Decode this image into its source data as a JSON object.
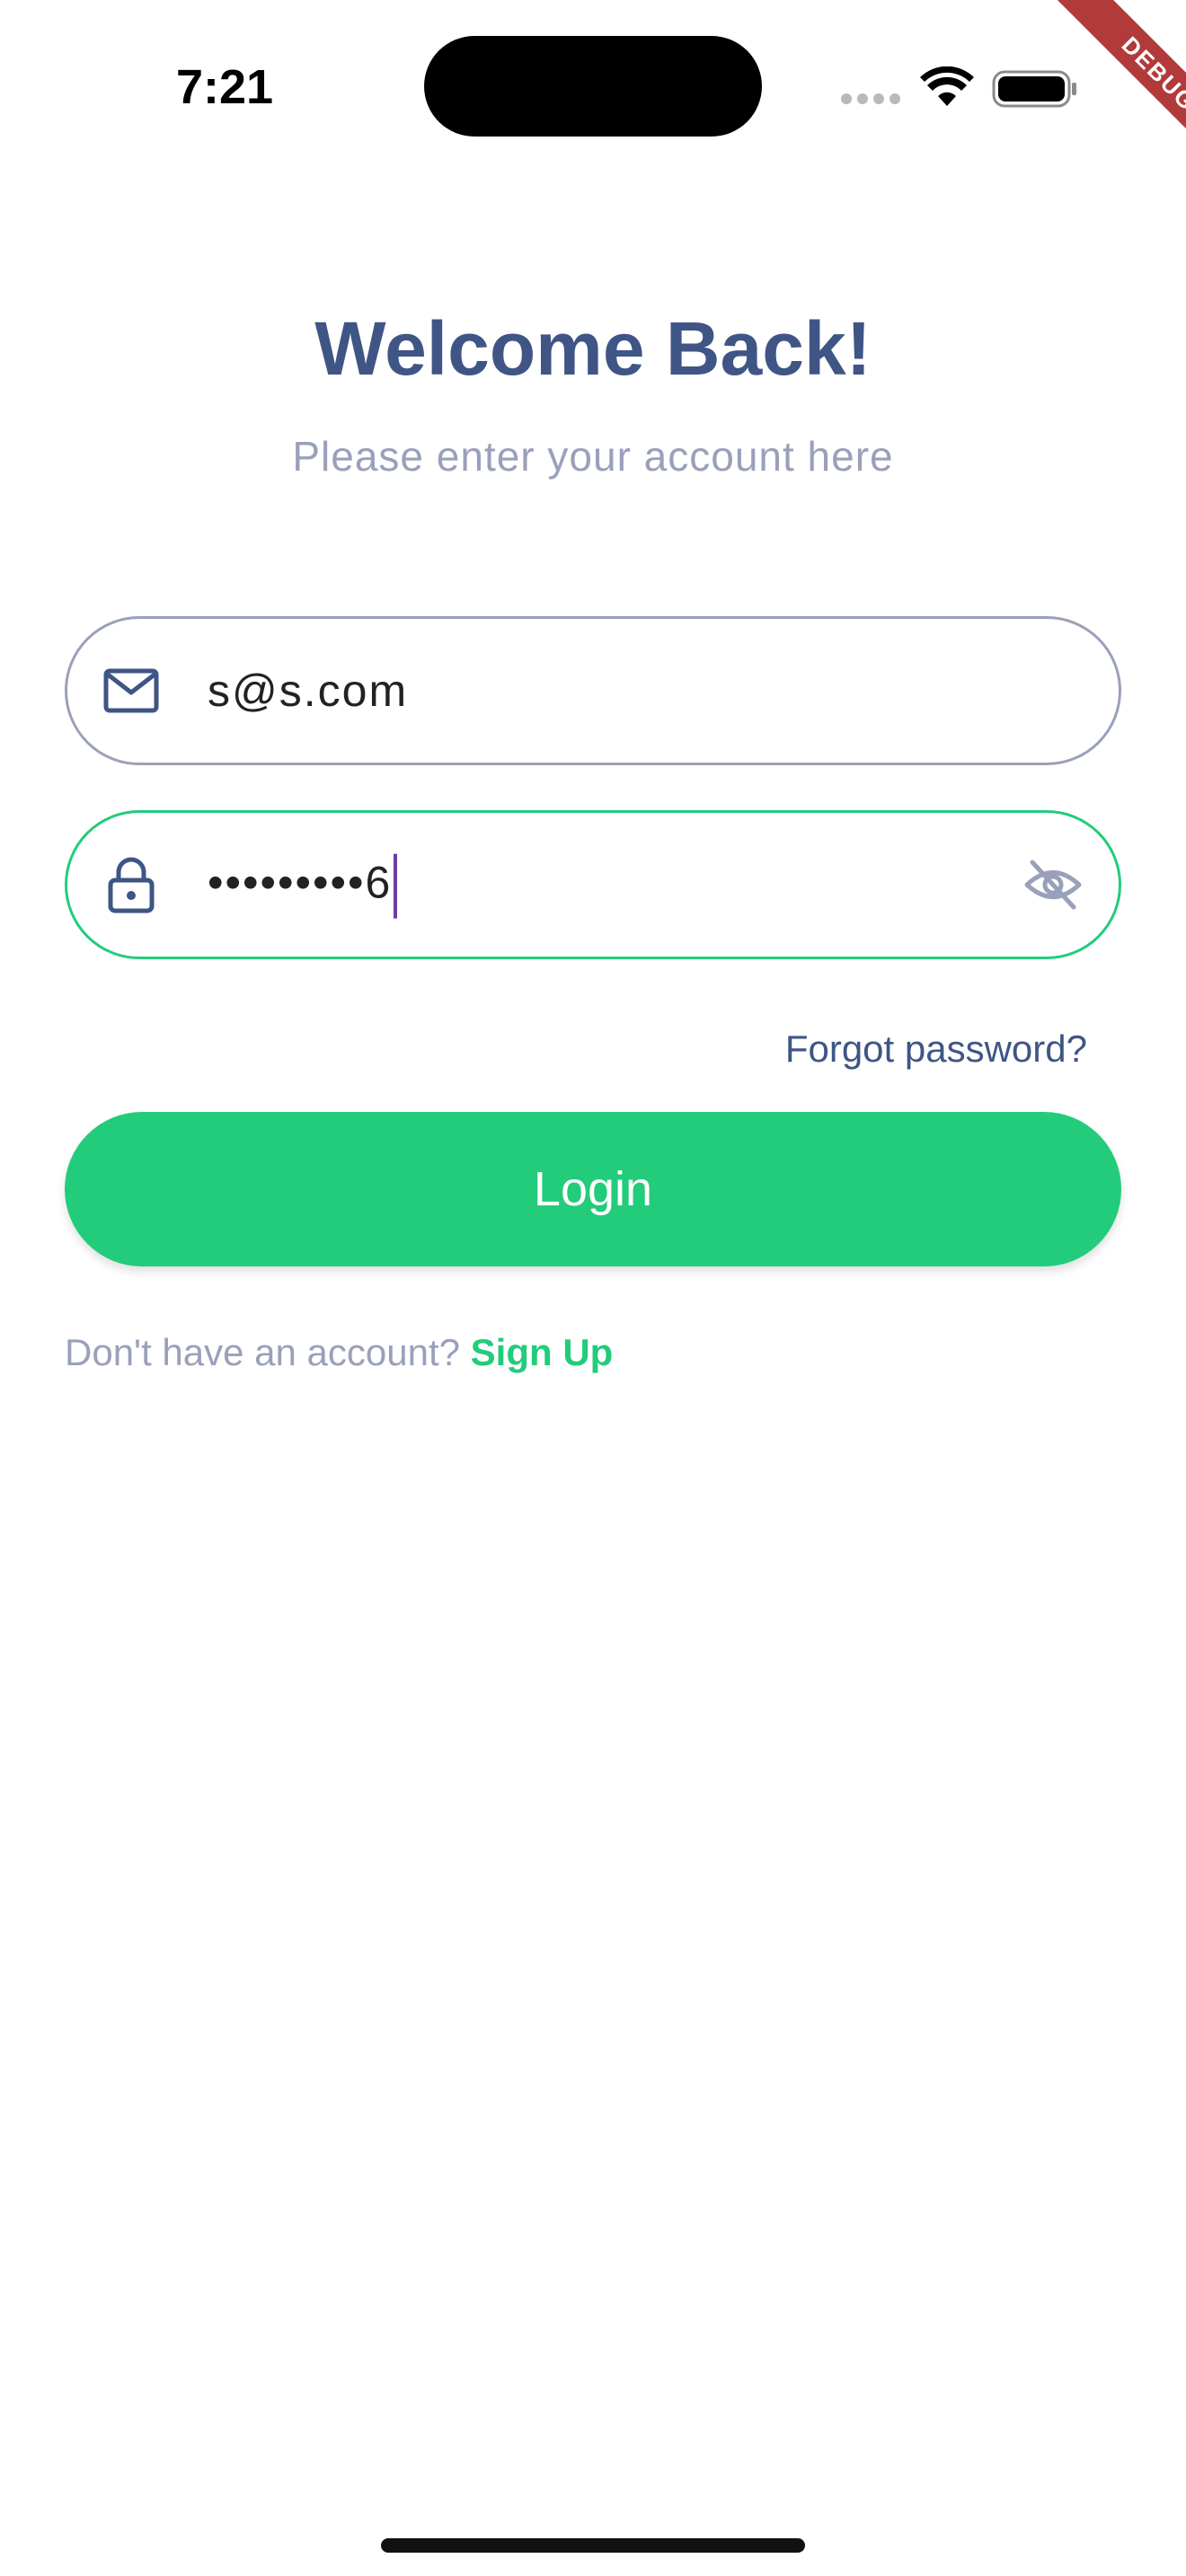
{
  "status_bar": {
    "time": "7:21",
    "debug_label": "DEBUG"
  },
  "header": {
    "title": "Welcome Back!",
    "subtitle": "Please enter your account here"
  },
  "form": {
    "email": {
      "value": "s@s.com",
      "icon": "mail-icon"
    },
    "password": {
      "value": "•••••••••6",
      "icon": "lock-icon",
      "toggle_icon": "eye-off-icon"
    },
    "forgot_label": "Forgot password?",
    "login_label": "Login",
    "signup_prompt": "Don't have an account?",
    "signup_label": "Sign Up"
  },
  "colors": {
    "primary": "#22cc7a",
    "heading": "#3f5585",
    "muted": "#9aa0bb"
  }
}
